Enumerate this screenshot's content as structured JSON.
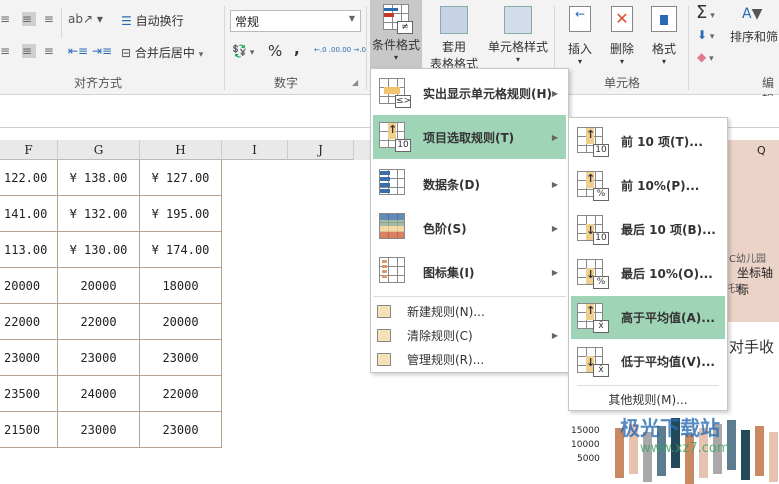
{
  "ribbon": {
    "wrap_text": "自动换行",
    "merge_center": "合并后居中",
    "align_group": "对齐方式",
    "number_format": "常规",
    "percent": "%",
    "comma": ",",
    "inc_decimal": "←.0 .00",
    "dec_decimal": ".00 →.0",
    "number_group": "数字",
    "cond_format": "条件格式",
    "table_format_1": "套用",
    "table_format_2": "表格格式",
    "cell_style": "单元格样式",
    "insert": "插入",
    "delete": "删除",
    "format": "格式",
    "cells_group": "单元格",
    "sum": "Σ",
    "sort_filter": "排序和筛",
    "edit_group": "编辑"
  },
  "columns": [
    "F",
    "G",
    "H",
    "I",
    "J"
  ],
  "rows": [
    [
      "122.00",
      "¥ 138.00",
      "¥ 127.00"
    ],
    [
      "141.00",
      "¥ 132.00",
      "¥ 195.00"
    ],
    [
      "113.00",
      "¥ 130.00",
      "¥ 174.00"
    ],
    [
      "20000",
      "20000",
      "18000"
    ],
    [
      "22000",
      "22000",
      "20000"
    ],
    [
      "23000",
      "23000",
      "23000"
    ],
    [
      "23500",
      "24000",
      "22000"
    ],
    [
      "21500",
      "23000",
      "23000"
    ]
  ],
  "chart": {
    "col": "Q",
    "cat": "C幼儿园",
    "axis_title": "坐标轴标",
    "legend": "托班",
    "title": "对手收",
    "yticks": [
      "15000",
      "10000",
      "5000"
    ]
  },
  "menu": {
    "items": [
      "实出显示单元格规则(H)",
      "项目选取规则(T)",
      "数据条(D)",
      "色阶(S)",
      "图标集(I)"
    ],
    "small": [
      "新建规则(N)...",
      "清除规则(C)",
      "管理规则(R)..."
    ]
  },
  "submenu": {
    "items": [
      "前 10 项(T)...",
      "前 10%(P)...",
      "最后 10 项(B)...",
      "最后 10%(O)...",
      "高于平均值(A)...",
      "低于平均值(V)..."
    ],
    "badges": [
      "10",
      "%",
      "10",
      "%",
      "x̄",
      "x̄"
    ],
    "other": "其他规则(M)..."
  },
  "watermark": {
    "name": "极光下载站",
    "url": "www.xz7.com"
  },
  "colors": {
    "highlight": "#9fd4b6",
    "chart_bg": "#ecd3c8",
    "cell_border": "#b5a48c"
  }
}
